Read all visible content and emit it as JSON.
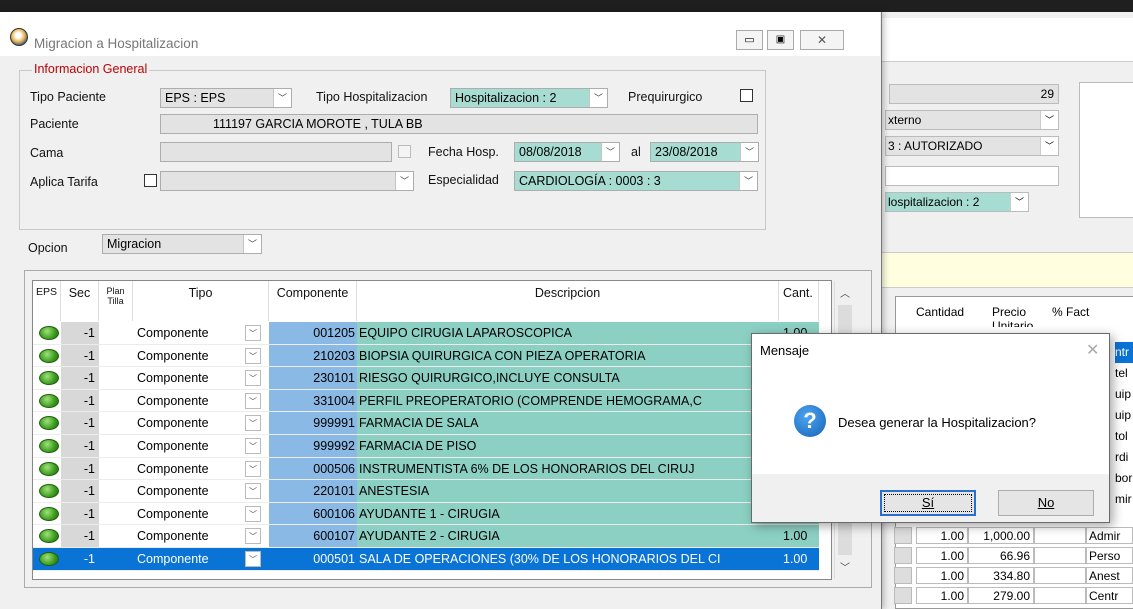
{
  "window": {
    "title": "Migracion a Hospitalizacion"
  },
  "info": {
    "group_title": "Informacion General",
    "tipo_paciente_label": "Tipo Paciente",
    "tipo_paciente_value": "EPS : EPS",
    "tipo_hosp_label": "Tipo Hospitalizacion",
    "tipo_hosp_value": "Hospitalizacion : 2",
    "prequirurgico_label": "Prequirurgico",
    "paciente_label": "Paciente",
    "paciente_value": "111197 GARCIA MOROTE , TULA BB",
    "cama_label": "Cama",
    "fecha_label": "Fecha Hosp.",
    "fecha_desde": "08/08/2018",
    "al_label": "al",
    "fecha_hasta": "23/08/2018",
    "aplica_tarifa_label": "Aplica Tarifa",
    "especialidad_label": "Especialidad",
    "especialidad_value": "CARDIOLOGÍA : 0003 : 3"
  },
  "opcion": {
    "label": "Opcion",
    "value": "Migracion"
  },
  "grid": {
    "headers": {
      "eps": "EPS",
      "sec": "Sec",
      "plan": "Plan",
      "tilla": "Tilla",
      "tipo": "Tipo",
      "componente": "Componente",
      "descripcion": "Descripcion",
      "cant": "Cant."
    },
    "rows": [
      {
        "sec": "-1",
        "tipo": "Componente",
        "componente": "001205",
        "descripcion": "EQUIPO CIRUGIA LAPAROSCOPICA",
        "cant": "1.00"
      },
      {
        "sec": "-1",
        "tipo": "Componente",
        "componente": "210203",
        "descripcion": "BIOPSIA QUIRURGICA CON PIEZA OPERATORIA",
        "cant": ""
      },
      {
        "sec": "-1",
        "tipo": "Componente",
        "componente": "230101",
        "descripcion": "RIESGO QUIRURGICO,INCLUYE CONSULTA",
        "cant": ""
      },
      {
        "sec": "-1",
        "tipo": "Componente",
        "componente": "331004",
        "descripcion": "PERFIL PREOPERATORIO (COMPRENDE HEMOGRAMA,C",
        "cant": ""
      },
      {
        "sec": "-1",
        "tipo": "Componente",
        "componente": "999991",
        "descripcion": "FARMACIA DE SALA",
        "cant": ""
      },
      {
        "sec": "-1",
        "tipo": "Componente",
        "componente": "999992",
        "descripcion": "FARMACIA DE PISO",
        "cant": ""
      },
      {
        "sec": "-1",
        "tipo": "Componente",
        "componente": "000506",
        "descripcion": "INSTRUMENTISTA 6% DE LOS HONORARIOS DEL CIRUJ",
        "cant": ""
      },
      {
        "sec": "-1",
        "tipo": "Componente",
        "componente": "220101",
        "descripcion": "ANESTESIA",
        "cant": ""
      },
      {
        "sec": "-1",
        "tipo": "Componente",
        "componente": "600106",
        "descripcion": "AYUDANTE 1 - CIRUGIA",
        "cant": ""
      },
      {
        "sec": "-1",
        "tipo": "Componente",
        "componente": "600107",
        "descripcion": "AYUDANTE 2 - CIRUGIA",
        "cant": "1.00"
      },
      {
        "sec": "-1",
        "tipo": "Componente",
        "componente": "000501",
        "descripcion": "SALA DE OPERACIONES (30% DE LOS HONORARIOS DEL CI",
        "cant": "1.00"
      }
    ]
  },
  "background": {
    "field_29": "29",
    "externo": "xterno",
    "autorizado": "3 : AUTORIZADO",
    "hosp": "lospitalizacion : 2",
    "headers": {
      "cantidad": "Cantidad",
      "precio": "Precio",
      "unitario": "Unitario",
      "fact": "% Fact"
    },
    "rows": [
      {
        "cant": "1.00",
        "precio": "1,000.00",
        "desc": "Admir"
      },
      {
        "cant": "1.00",
        "precio": "66.96",
        "desc": "Perso"
      },
      {
        "cant": "1.00",
        "precio": "334.80",
        "desc": "Anest"
      },
      {
        "cant": "1.00",
        "precio": "279.00",
        "desc": "Centr"
      }
    ],
    "side_labels": [
      "ntr",
      "tel",
      "uip",
      "uip",
      "tol",
      "rdi",
      "bor",
      "mir"
    ]
  },
  "dialog": {
    "title": "Mensaje",
    "message": "Desea generar la Hospitalizacion?",
    "yes": "Sí",
    "no": "No"
  }
}
